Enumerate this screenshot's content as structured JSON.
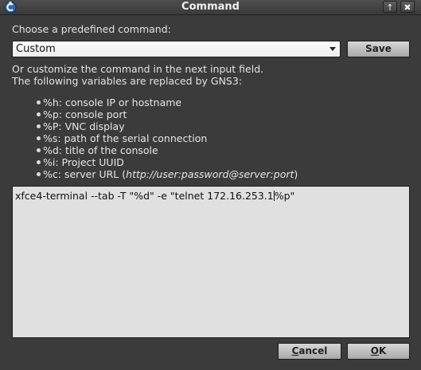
{
  "window": {
    "title": "Command",
    "maximize_label": "↑",
    "close_label": "✖"
  },
  "choose_label": "Choose a predefined command:",
  "command_select": {
    "selected": "Custom"
  },
  "save_label": "Save",
  "customize_line1": "Or customize the command in the next input field.",
  "customize_line2": "The following variables are replaced by GNS3:",
  "variables": [
    "%h: console IP or hostname",
    "%p: console port",
    "%P: VNC display",
    "%s: path of the serial connection",
    "%d: title of the console",
    "%i: Project UUID"
  ],
  "var_c": {
    "prefix": "%c: server URL (",
    "url": "http://user:password@server:port",
    "suffix": ")"
  },
  "command": {
    "before_caret": "xfce4-terminal --tab -T \"%d\" -e \"telnet 172.16.253.1",
    "after_caret": "%p\""
  },
  "buttons": {
    "cancel_first": "C",
    "cancel_rest": "ancel",
    "ok_first": "O",
    "ok_rest": "K"
  }
}
